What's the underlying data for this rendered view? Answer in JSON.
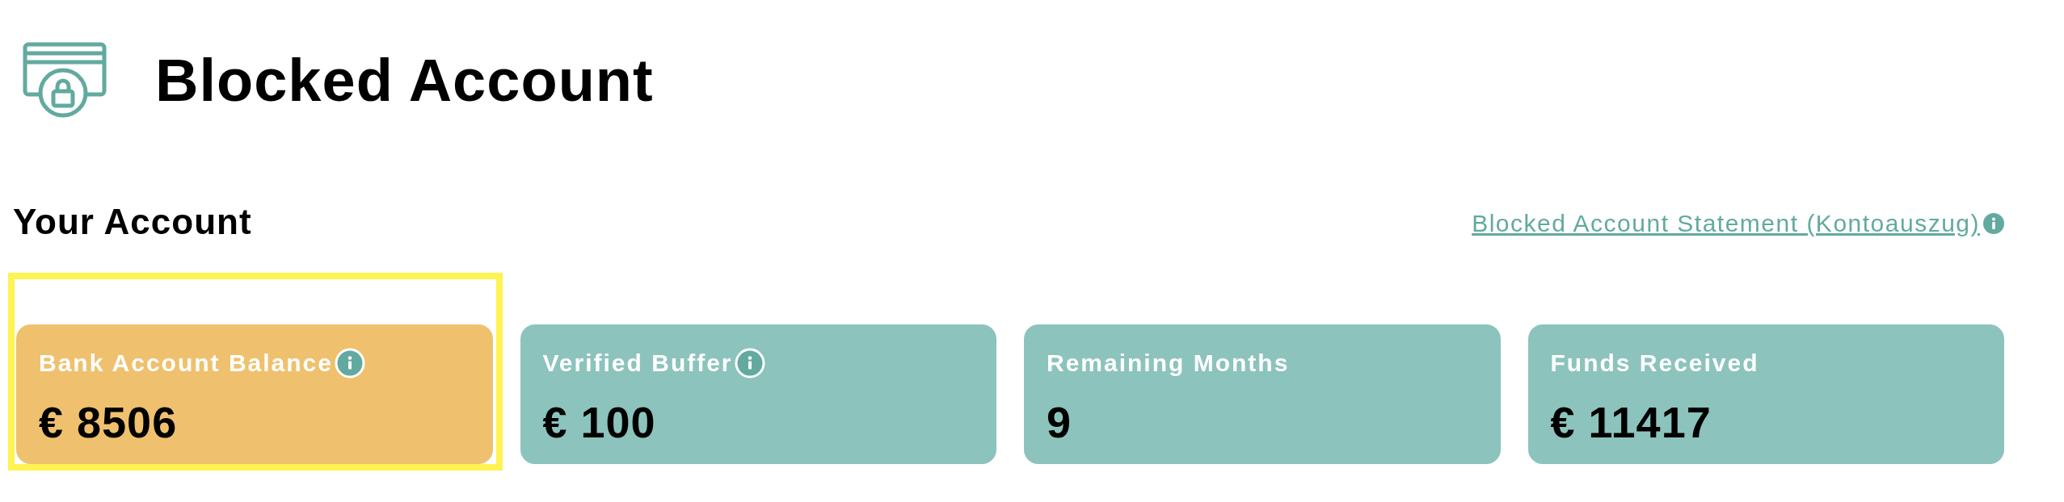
{
  "header": {
    "title": "Blocked Account"
  },
  "section": {
    "title": "Your Account",
    "link": "Blocked Account Statement (Kontoauszug)",
    "link_info": true
  },
  "cards": [
    {
      "label": "Bank Account Balance",
      "value": "€ 8506",
      "info": true,
      "color": "#efc16e",
      "highlighted": true
    },
    {
      "label": "Verified Buffer",
      "value": "€ 100",
      "info": true,
      "color": "#8cc3bd",
      "highlighted": false
    },
    {
      "label": "Remaining Months",
      "value": "9",
      "info": false,
      "color": "#8cc3bd",
      "highlighted": false
    },
    {
      "label": "Funds Received",
      "value": "€ 11417",
      "info": false,
      "color": "#8cc3bd",
      "highlighted": false
    }
  ]
}
